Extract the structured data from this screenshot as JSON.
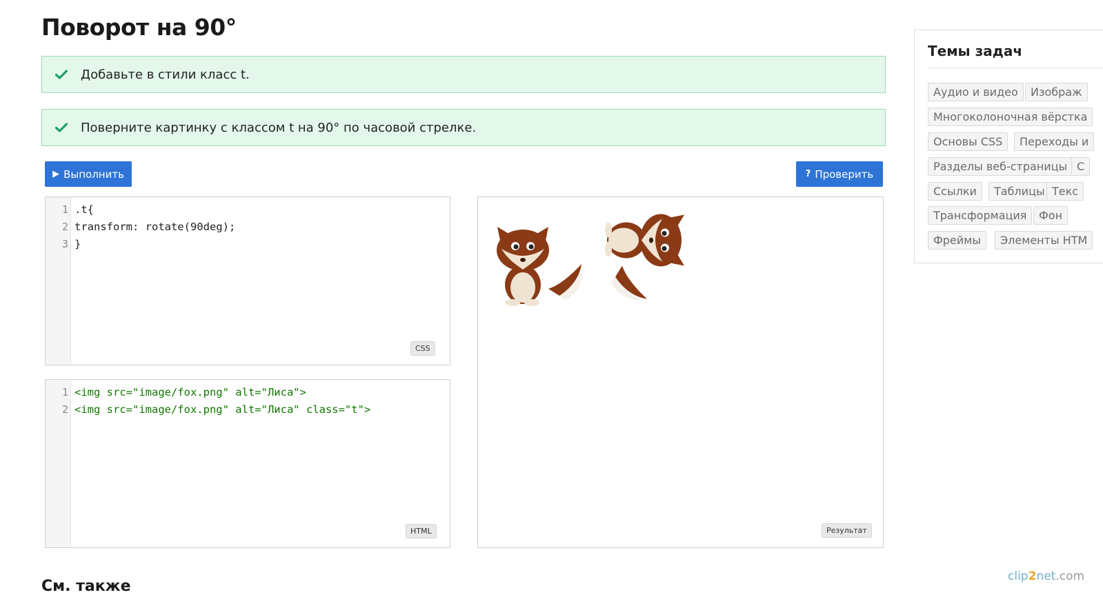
{
  "page": {
    "title": "Поворот на 90°"
  },
  "tasks": [
    {
      "text": "Добавьте в стили класс t.",
      "status": "done"
    },
    {
      "text": "Поверните картинку с классом t на 90° по часовой стрелке.",
      "status": "done"
    }
  ],
  "toolbar": {
    "run_label": "Выполнить",
    "check_label": "Проверить"
  },
  "css_editor": {
    "line_numbers": [
      "1",
      "2",
      "3"
    ],
    "lines": [
      ".t{",
      "transform: rotate(90deg);",
      "}"
    ],
    "label": "CSS"
  },
  "html_editor": {
    "line_numbers": [
      "1",
      "2"
    ],
    "lines": [
      "<img src=\"image/fox.png\" alt=\"Лиса\">",
      "<img src=\"image/fox.png\" alt=\"Лиса\" class=\"t\">"
    ],
    "label": "HTML"
  },
  "result": {
    "label": "Результат"
  },
  "sidebar": {
    "title": "Темы задач",
    "tags": [
      "Аудио и видео",
      "Изображ",
      "Многоколоночная вёрстка",
      "Основы CSS",
      "Переходы и",
      "Разделы веб-страницы",
      "С",
      "Ссылки",
      "Таблицы",
      "Текс",
      "Трансформация",
      "Фон",
      "Фреймы",
      "Элементы HTM"
    ]
  },
  "footer": {
    "see_also": "См. также"
  },
  "watermark": {
    "part1": "clip",
    "part2": "2",
    "part3": "net",
    "part4": ".com"
  },
  "colors": {
    "accent": "#2e74d6",
    "success_bg": "#e3f8ea",
    "success_border": "#9fd9b4",
    "check": "#1f9d6b"
  }
}
